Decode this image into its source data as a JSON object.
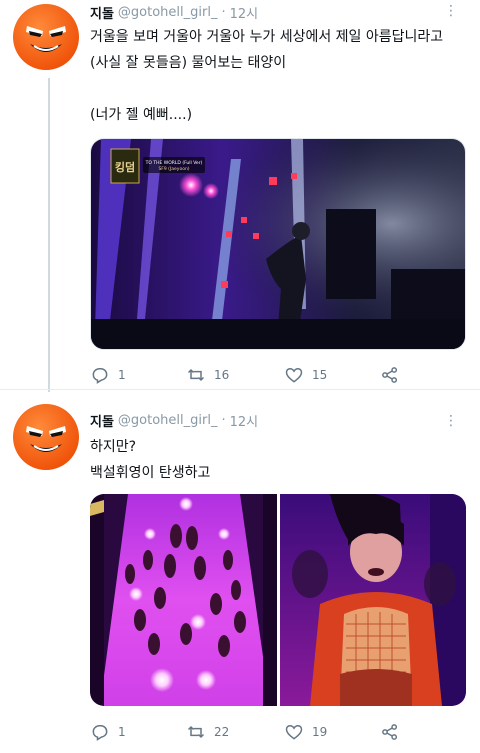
{
  "tweets": [
    {
      "name": "지돌",
      "handle": "@gotohell_girl_",
      "time": "12시",
      "text": "거울을 보며 거울아 거울아 누가 세상에서 제일 아름답니라고\n(사실 잘 못들음) 물어보는 태양이\n\n(너가 젤 예뻐....)",
      "media_overlay": {
        "show_logo": "킹덤",
        "subtitle": "TO THE WORLD (Full Ver)",
        "song_label": "SF9 (Jaeyoon)"
      },
      "stats": {
        "replies": "1",
        "retweets": "16",
        "likes": "15"
      }
    },
    {
      "name": "지돌",
      "handle": "@gotohell_girl_",
      "time": "12시",
      "text": "하지만?\n백설휘영이 탄생하고",
      "stats": {
        "replies": "1",
        "retweets": "22",
        "likes": "19"
      }
    }
  ],
  "ui": {
    "dot": "·",
    "more_glyph": "⋮"
  },
  "colors": {
    "avatar": "#f0560c",
    "icon_gray": "#657786",
    "stage_purple": "#7a20d0",
    "stage_magenta": "#e028f0"
  },
  "icons": [
    "reply-icon",
    "retweet-icon",
    "heart-icon",
    "share-icon",
    "more-icon"
  ]
}
